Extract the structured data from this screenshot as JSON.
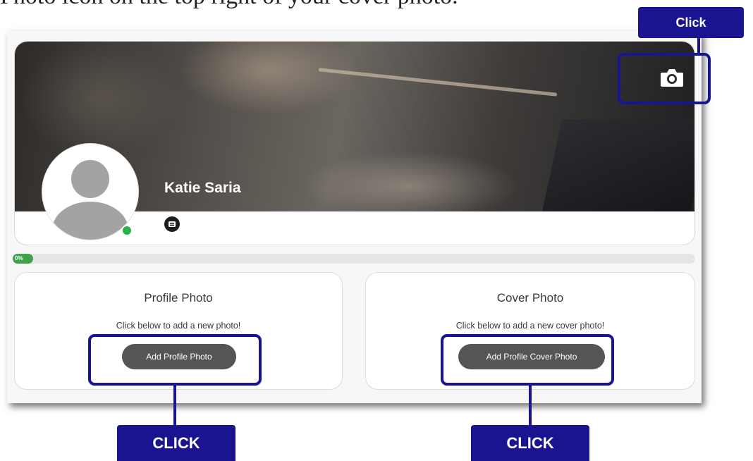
{
  "instruction_text": "Photo icon on the top right of your cover photo.",
  "profile": {
    "name": "Katie Saria",
    "completion_label": "0%",
    "completion_fraction": 0.03
  },
  "profile_photo_card": {
    "title": "Profile Photo",
    "description": "Click below to add a new photo!",
    "button_label": "Add Profile Photo"
  },
  "cover_photo_card": {
    "title": "Cover Photo",
    "description": "Click below to add a new cover photo!",
    "button_label": "Add Profile Cover Photo"
  },
  "annotations": {
    "top_callout": "Click",
    "bottom_left_callout": "CLICK",
    "bottom_right_callout": "CLICK"
  },
  "colors": {
    "annotation": "#1a1490",
    "button": "#555555",
    "online": "#27b34a",
    "progress": "#3fa34d"
  },
  "icons": [
    "camera-icon",
    "avatar-placeholder-icon",
    "badge-icon"
  ]
}
